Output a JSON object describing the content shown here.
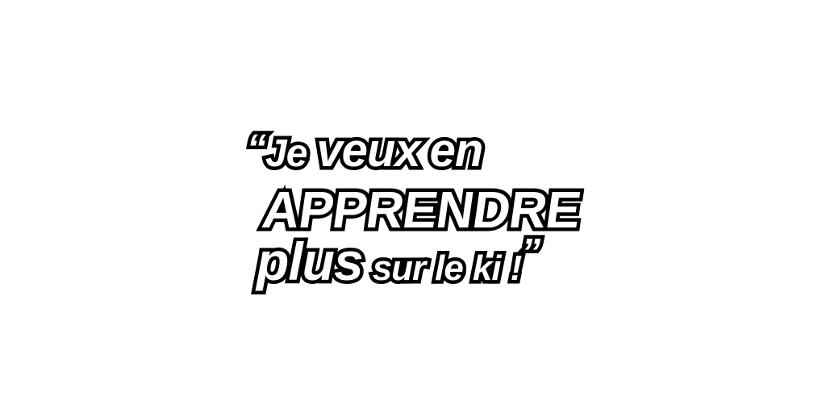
{
  "quote": {
    "open_quote": "“",
    "line1": {
      "w1": "Je",
      "w2": "veux",
      "w3": "en"
    },
    "line2": {
      "w1": "APPRENDRE"
    },
    "line3": {
      "w1": "plus",
      "w2": "sur",
      "w3": "le",
      "w4": "ki",
      "w5": "!"
    },
    "close_quote": "”"
  },
  "colors": {
    "background": "#ffffff",
    "text_fill": "#ffffff",
    "text_outline": "#000000"
  }
}
